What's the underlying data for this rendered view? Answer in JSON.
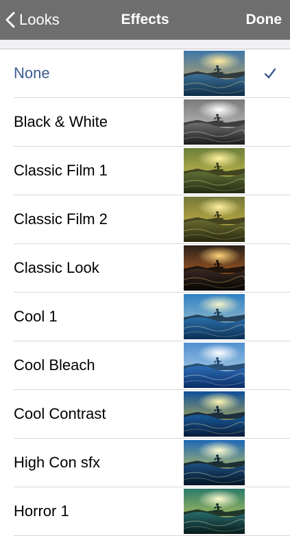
{
  "navbar": {
    "back_label": "Looks",
    "title": "Effects",
    "done_label": "Done",
    "background": "#6e6e6e"
  },
  "accent_color": "#3b5b8e",
  "effects": [
    {
      "label": "None",
      "selected": true,
      "tone": "natural",
      "icon": "surfer-thumbnail"
    },
    {
      "label": "Black & White",
      "selected": false,
      "tone": "mono",
      "icon": "surfer-thumbnail"
    },
    {
      "label": "Classic Film 1",
      "selected": false,
      "tone": "olive",
      "icon": "surfer-thumbnail"
    },
    {
      "label": "Classic Film 2",
      "selected": false,
      "tone": "olive2",
      "icon": "surfer-thumbnail"
    },
    {
      "label": "Classic Look",
      "selected": false,
      "tone": "dark-warm",
      "icon": "surfer-thumbnail"
    },
    {
      "label": "Cool 1",
      "selected": false,
      "tone": "cool",
      "icon": "surfer-thumbnail"
    },
    {
      "label": "Cool Bleach",
      "selected": false,
      "tone": "bleach",
      "icon": "surfer-thumbnail"
    },
    {
      "label": "Cool Contrast",
      "selected": false,
      "tone": "contrast",
      "icon": "surfer-thumbnail"
    },
    {
      "label": "High Con sfx",
      "selected": false,
      "tone": "high",
      "icon": "surfer-thumbnail"
    },
    {
      "label": "Horror 1",
      "selected": false,
      "tone": "horror",
      "icon": "surfer-thumbnail"
    }
  ]
}
